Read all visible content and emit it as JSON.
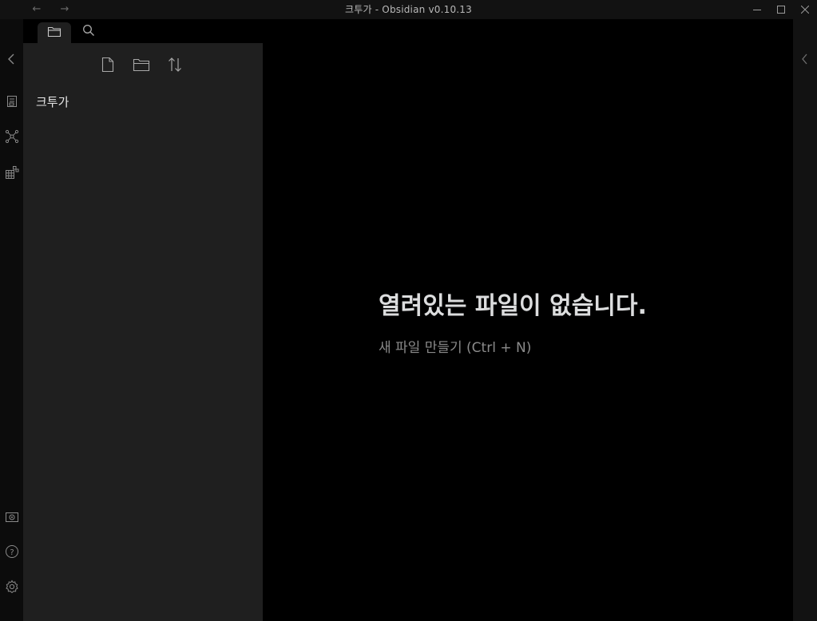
{
  "window": {
    "title": "크투가 - Obsidian v0.10.13",
    "back_icon": "arrow-left-icon",
    "forward_icon": "arrow-right-icon",
    "controls": [
      "minimize-icon",
      "maximize-icon",
      "close-icon"
    ]
  },
  "ribbon": {
    "top_items": [
      "collapse-left-icon",
      "open-quick-switcher-icon",
      "graph-view-icon",
      "open-sandbox-icon"
    ],
    "bottom_items": [
      "open-vault-icon",
      "help-icon",
      "settings-icon"
    ]
  },
  "sidebar": {
    "tabs": [
      "folder-icon",
      "search-icon"
    ],
    "tools": [
      "new-note-icon",
      "new-folder-icon",
      "sort-icon"
    ],
    "vault_name": "크투가"
  },
  "editor": {
    "empty_title": "열려있는 파일이 없습니다.",
    "empty_action": "새 파일 만들기 (Ctrl + N)"
  },
  "right_sidebar": {
    "collapse_icon": "collapse-right-icon"
  },
  "colors": {
    "background": "#000000",
    "panel": "#1f1f1f",
    "titlebar": "#121212",
    "text": "#dcddde",
    "muted": "#8a8a8a"
  }
}
